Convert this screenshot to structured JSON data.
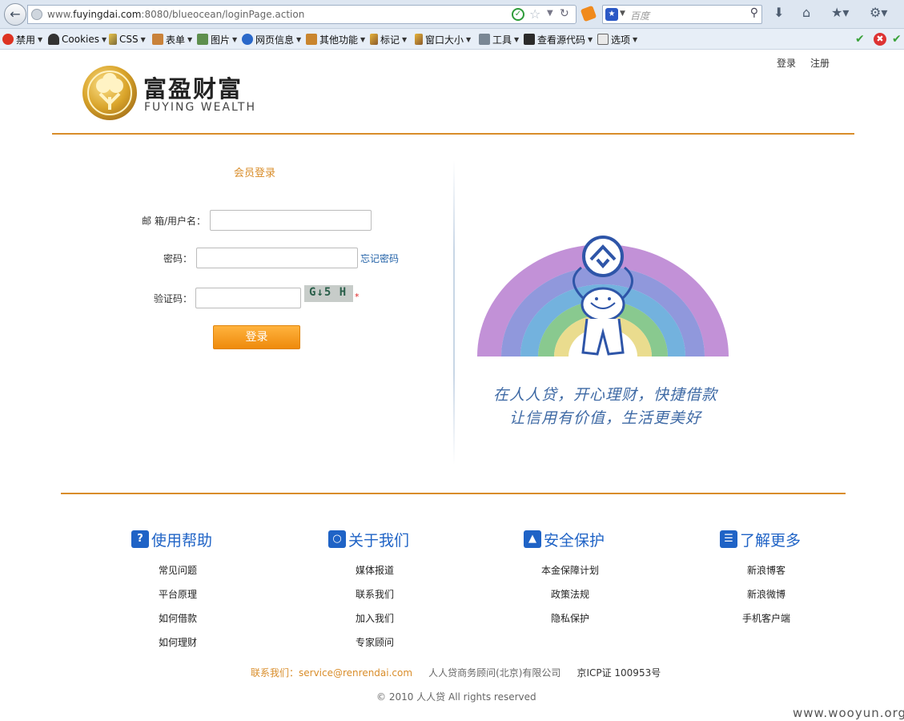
{
  "browser": {
    "url_prefix": "www.",
    "url_domain": "fuyingdai.com",
    "url_rest": ":8080/blueocean/loginPage.action",
    "search_placeholder": "百度",
    "toolbar_items": [
      "禁用",
      "Cookies",
      "CSS",
      "表单",
      "图片",
      "网页信息",
      "其他功能",
      "标记",
      "窗口大小",
      "工具",
      "查看源代码",
      "选项"
    ]
  },
  "header": {
    "login_link": "登录",
    "register_link": "注册",
    "logo_cn": "富盈财富",
    "logo_en": "FUYING WEALTH"
  },
  "login": {
    "title": "会员登录",
    "username_label": "邮 箱/用户名：",
    "password_label": "密码：",
    "forgot_link": "忘记密码",
    "captcha_label": "验证码：",
    "captcha_text": "G↓5 H",
    "required_mark": "*",
    "submit_label": "登录"
  },
  "promo": {
    "slogan_line1": "在人人贷，开心理财，快捷借款",
    "slogan_line2": "让信用有价值，生活更美好"
  },
  "footer": {
    "columns": [
      {
        "title": "使用帮助",
        "icon": "question-icon",
        "links": [
          "常见问题",
          "平台原理",
          "如何借款",
          "如何理财"
        ]
      },
      {
        "title": "关于我们",
        "icon": "people-icon",
        "links": [
          "媒体报道",
          "联系我们",
          "加入我们",
          "专家顾问"
        ]
      },
      {
        "title": "安全保护",
        "icon": "shield-icon",
        "links": [
          "本金保障计划",
          "政策法规",
          "隐私保护"
        ]
      },
      {
        "title": "了解更多",
        "icon": "document-icon",
        "links": [
          "新浪博客",
          "新浪微博",
          "手机客户端"
        ]
      }
    ],
    "contact": "联系我们：service@renrendai.com",
    "company": "人人贷商务顾问(北京)有限公司",
    "icp": "京ICP证 100953号",
    "copyright": "© 2010 人人贷 All rights reserved"
  },
  "watermark": "www.wooyun.org",
  "colors": {
    "accent_orange": "#d98d2a",
    "footer_blue": "#1f63c6",
    "button_orange": "#ee8a0c"
  }
}
